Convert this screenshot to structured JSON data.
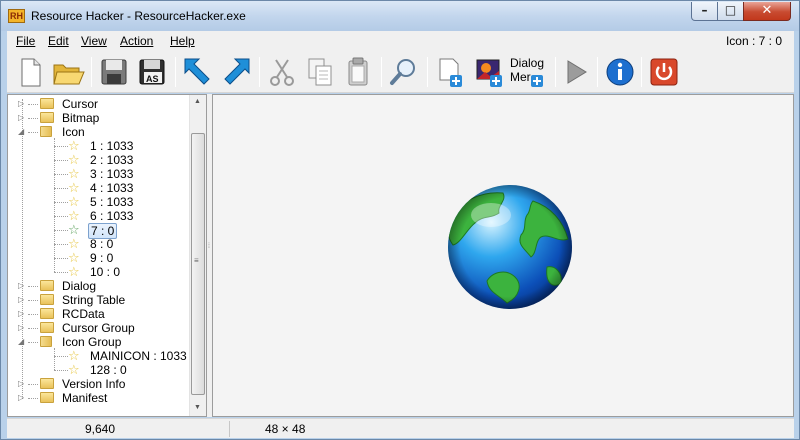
{
  "window": {
    "title": "Resource Hacker - ResourceHacker.exe",
    "logo_text": "RH"
  },
  "caption_buttons": {
    "minimize": "–",
    "maximize": "□",
    "close": "✕"
  },
  "menu": [
    {
      "label": "File"
    },
    {
      "label": "Edit"
    },
    {
      "label": "View"
    },
    {
      "label": "Action"
    },
    {
      "label": "Help"
    }
  ],
  "menu_status": "Icon : 7 : 0",
  "toolbar": {
    "dialog_menu_label_1": "Dialog",
    "dialog_menu_label_2": "Mer",
    "saveas_label": "AS",
    "icons": [
      "new-file-icon",
      "open-folder-icon",
      "save-icon",
      "save-as-icon",
      "back-arrow-icon",
      "forward-arrow-icon",
      "cut-icon",
      "copy-icon",
      "paste-icon",
      "search-icon",
      "add-resource-icon",
      "add-image-resource-icon",
      "add-dialog-menu-icon",
      "run-script-icon",
      "info-icon",
      "exit-icon"
    ]
  },
  "tree": {
    "nodes": [
      {
        "label": "Cursor",
        "kind": "folder",
        "level": 0
      },
      {
        "label": "Bitmap",
        "kind": "folder",
        "level": 0
      },
      {
        "label": "Icon",
        "kind": "folder-open",
        "level": 0,
        "expanded": true
      },
      {
        "label": "1 : 1033",
        "kind": "star",
        "level": 1
      },
      {
        "label": "2 : 1033",
        "kind": "star",
        "level": 1
      },
      {
        "label": "3 : 1033",
        "kind": "star",
        "level": 1
      },
      {
        "label": "4 : 1033",
        "kind": "star",
        "level": 1
      },
      {
        "label": "5 : 1033",
        "kind": "star",
        "level": 1
      },
      {
        "label": "6 : 1033",
        "kind": "star",
        "level": 1
      },
      {
        "label": "7 : 0",
        "kind": "star",
        "level": 1,
        "selected": true
      },
      {
        "label": "8 : 0",
        "kind": "star",
        "level": 1
      },
      {
        "label": "9 : 0",
        "kind": "star",
        "level": 1
      },
      {
        "label": "10 : 0",
        "kind": "star",
        "level": 1
      },
      {
        "label": "Dialog",
        "kind": "folder",
        "level": 0
      },
      {
        "label": "String Table",
        "kind": "folder",
        "level": 0
      },
      {
        "label": "RCData",
        "kind": "folder",
        "level": 0
      },
      {
        "label": "Cursor Group",
        "kind": "folder",
        "level": 0
      },
      {
        "label": "Icon Group",
        "kind": "folder-open",
        "level": 0,
        "expanded": true
      },
      {
        "label": "MAINICON : 1033",
        "kind": "star",
        "level": 1
      },
      {
        "label": "128 : 0",
        "kind": "star",
        "level": 1
      },
      {
        "label": "Version Info",
        "kind": "folder",
        "level": 0
      },
      {
        "label": "Manifest",
        "kind": "folder",
        "level": 0
      }
    ]
  },
  "preview": {
    "icon": "globe-icon"
  },
  "statusbar": {
    "left": "9,640",
    "right": "48 × 48"
  },
  "colors": {
    "accent": "#2b72c9",
    "selection_border": "#7da2ce",
    "exit_red": "#d9482b"
  }
}
